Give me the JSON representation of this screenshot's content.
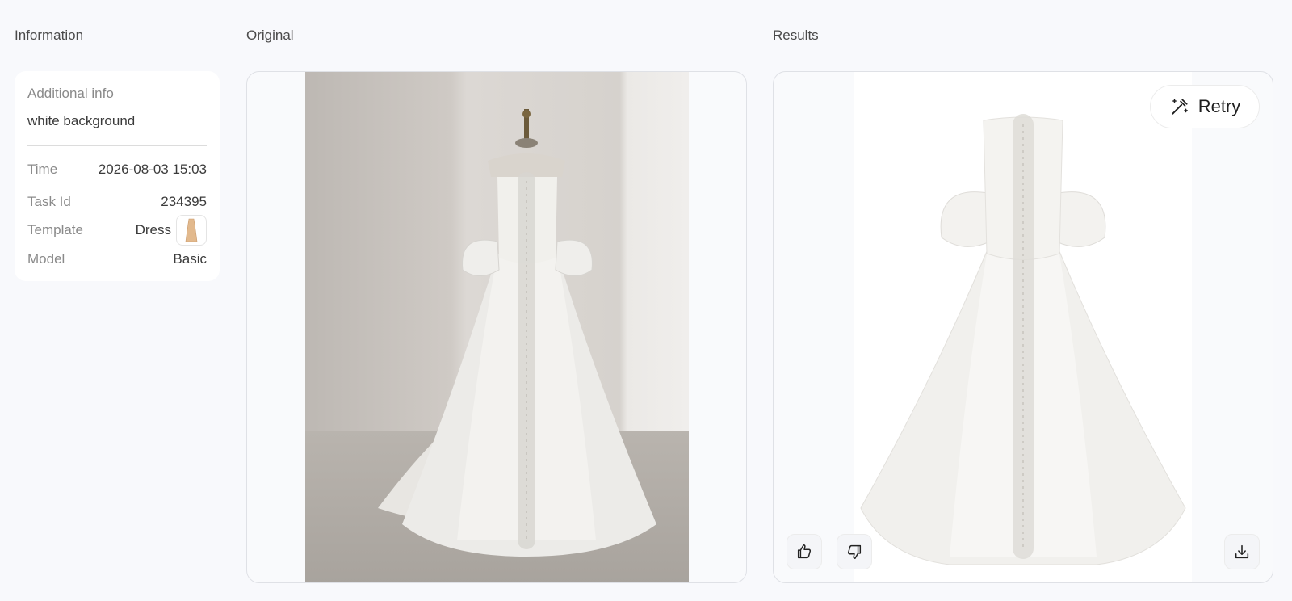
{
  "sections": {
    "information": "Information",
    "original": "Original",
    "results": "Results"
  },
  "info": {
    "additional_label": "Additional info",
    "additional_value": "white background",
    "time_label": "Time",
    "time_value": "2026-08-03 15:03",
    "task_label": "Task Id",
    "task_value": "234395",
    "template_label": "Template",
    "template_value": "Dress",
    "model_label": "Model",
    "model_value": "Basic"
  },
  "results": {
    "retry_label": "Retry"
  },
  "icons": {
    "retry": "magic-wand-icon",
    "like": "thumbs-up-icon",
    "dislike": "thumbs-down-icon",
    "download": "download-icon"
  }
}
